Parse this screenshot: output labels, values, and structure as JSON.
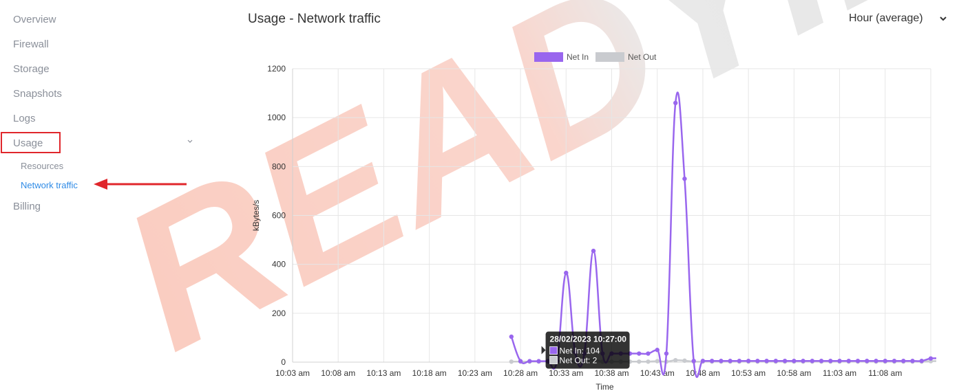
{
  "sidebar": {
    "items": [
      {
        "label": "Overview"
      },
      {
        "label": "Firewall"
      },
      {
        "label": "Storage"
      },
      {
        "label": "Snapshots"
      },
      {
        "label": "Logs"
      },
      {
        "label": "Usage"
      },
      {
        "label": "Billing"
      }
    ],
    "usage_sub": [
      {
        "label": "Resources"
      },
      {
        "label": "Network traffic"
      }
    ]
  },
  "header": {
    "title": "Usage - Network traffic",
    "range_selected": "Hour (average)"
  },
  "watermark": "READYIDC",
  "colors": {
    "net_in": "#9966ee",
    "net_out": "#c9cbcf",
    "active_link": "#2f8be6",
    "highlight": "#e0262b"
  },
  "chart_data": {
    "type": "line",
    "xlabel": "Time",
    "ylabel": "kBytes/s",
    "ylim": [
      0,
      1200
    ],
    "yticks": [
      0,
      200,
      400,
      600,
      800,
      1000,
      1200
    ],
    "xticks": [
      "10:03 am",
      "10:08 am",
      "10:13 am",
      "10:18 am",
      "10:23 am",
      "10:28 am",
      "10:33 am",
      "10:38 am",
      "10:43 am",
      "10:48 am",
      "10:53 am",
      "10:58 am",
      "11:03 am",
      "11:08 am"
    ],
    "x_start_minute": 3,
    "x_end_minute": 73,
    "legend_position": "top-center",
    "grid": true,
    "series": [
      {
        "name": "Net In",
        "start_minute": 27,
        "values": [
          104,
          4,
          4,
          4,
          4,
          5,
          365,
          40,
          35,
          455,
          35,
          35,
          35,
          35,
          35,
          35,
          50,
          35,
          1060,
          750,
          5,
          5,
          5,
          5,
          5,
          5,
          5,
          5,
          5,
          5,
          5,
          5,
          5,
          5,
          5,
          5,
          5,
          5,
          5,
          5,
          5,
          5,
          5,
          5,
          5,
          5,
          15,
          15
        ]
      },
      {
        "name": "Net Out",
        "start_minute": 27,
        "values": [
          2,
          2,
          2,
          2,
          2,
          2,
          10,
          2,
          2,
          10,
          2,
          2,
          2,
          2,
          2,
          2,
          4,
          2,
          8,
          6,
          2,
          2,
          2,
          2,
          2,
          2,
          2,
          2,
          2,
          2,
          2,
          2,
          2,
          2,
          2,
          2,
          2,
          2,
          2,
          2,
          2,
          2,
          2,
          2,
          2,
          2,
          4,
          4
        ]
      }
    ],
    "tooltip": {
      "title": "28/02/2023 10:27:00",
      "lines": [
        "Net In: 104",
        "Net Out: 2"
      ]
    }
  }
}
